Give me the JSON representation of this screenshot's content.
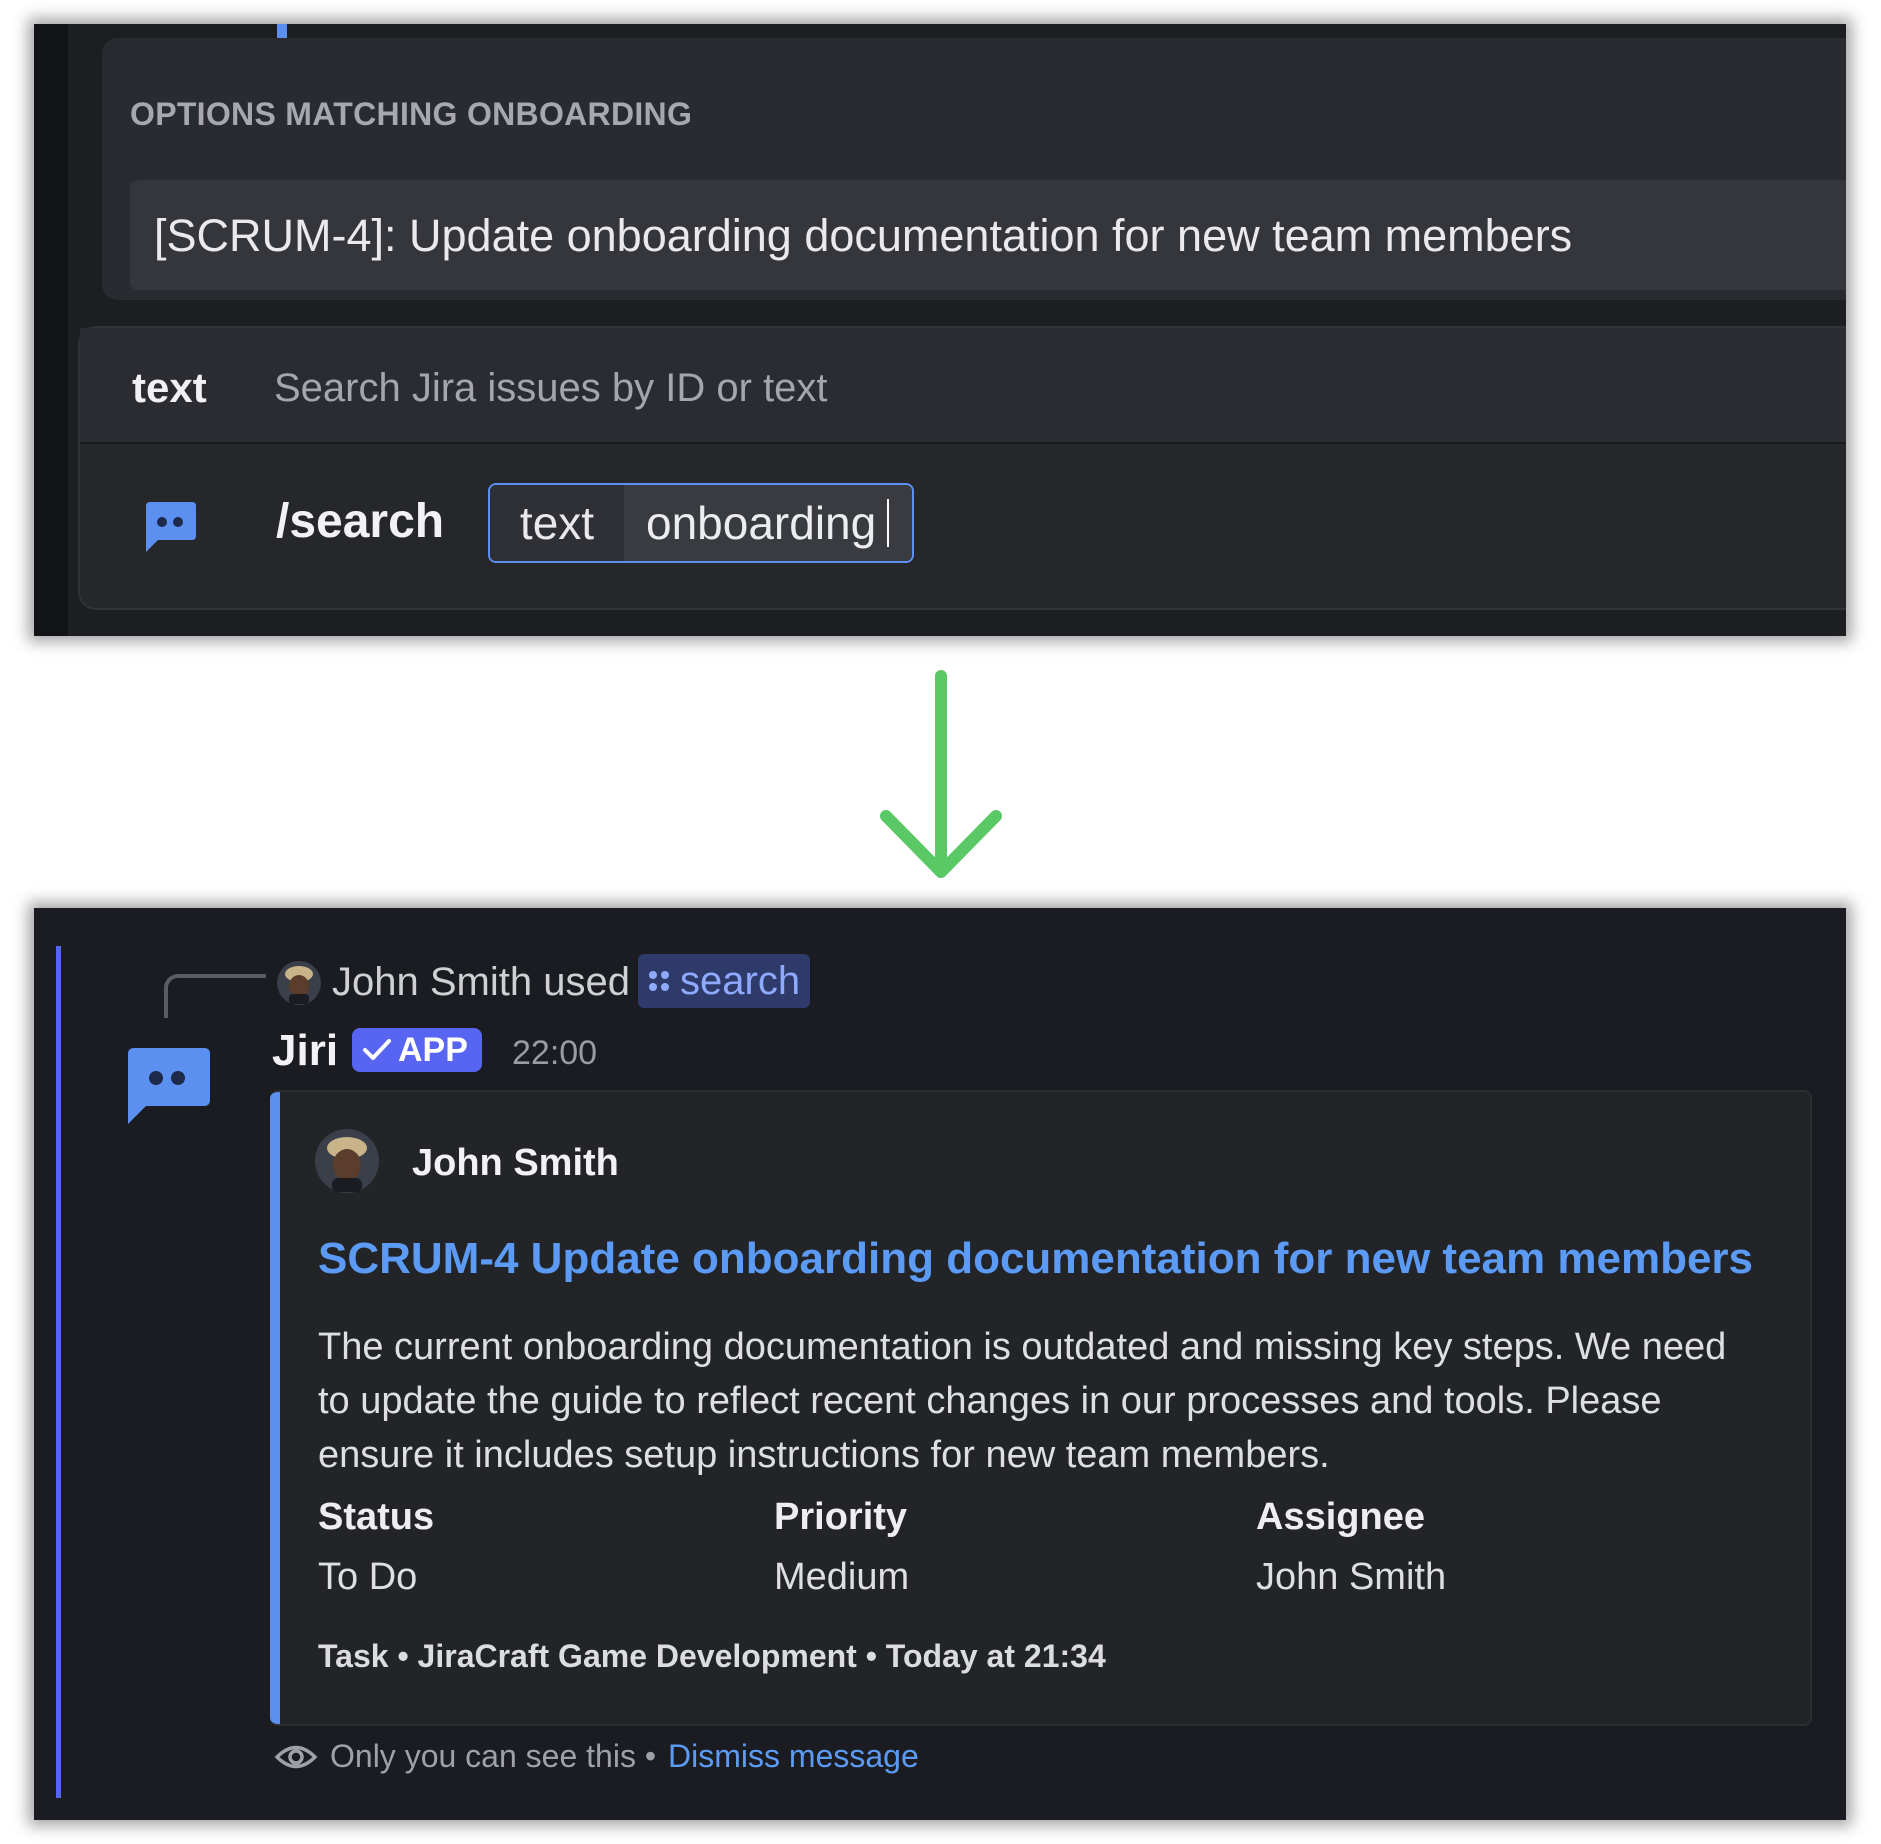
{
  "top_panel": {
    "options_header": "OPTIONS MATCHING ONBOARDING",
    "options": [
      {
        "label": "[SCRUM-4]: Update onboarding documentation for new team members"
      }
    ],
    "hint": {
      "option_name": "text",
      "option_description": "Search Jira issues by ID or text"
    },
    "composer": {
      "command": "/search",
      "option_key": "text",
      "option_value": "onboarding"
    }
  },
  "bottom_panel": {
    "interaction": {
      "user": "John Smith",
      "verb": "used",
      "command": "search"
    },
    "message": {
      "author": "Jiri",
      "badge": "APP",
      "time": "22:00"
    },
    "embed": {
      "author": "John Smith",
      "title": "SCRUM-4 Update onboarding documentation for new team members",
      "description": "The current onboarding documentation is outdated and missing key steps. We need to update the guide to reflect recent changes in our processes and tools. Please ensure it includes setup instructions for new team members.",
      "fields": [
        {
          "name": "Status",
          "value": "To Do"
        },
        {
          "name": "Priority",
          "value": "Medium"
        },
        {
          "name": "Assignee",
          "value": "John Smith"
        }
      ],
      "footer": "Task • JiraCraft Game Development • Today at 21:34"
    },
    "ephemeral": {
      "notice": "Only you can see this •",
      "dismiss": "Dismiss message"
    }
  },
  "colors": {
    "accent_blue": "#5b8ff0",
    "link_blue": "#5c9bf5",
    "blurple": "#5865f2",
    "arrow_green": "#5ac864",
    "background_dark": "#1d1e22"
  },
  "icons": [
    "bot-icon",
    "avatar-icon",
    "command-icon",
    "checkmark-icon",
    "eye-icon",
    "down-arrow-icon"
  ]
}
